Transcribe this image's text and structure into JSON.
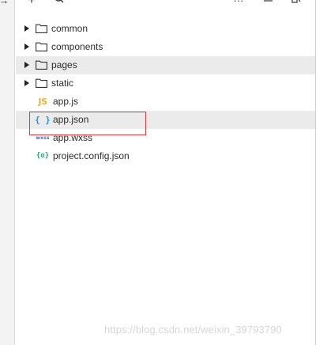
{
  "toolbar": {
    "icons": [
      "arrow-right-icon",
      "plus-icon",
      "search-icon",
      "more-icon",
      "collapse-icon",
      "layout-icon"
    ]
  },
  "tree": {
    "items": [
      {
        "label": "common",
        "type": "folder",
        "highlighted": false
      },
      {
        "label": "components",
        "type": "folder",
        "highlighted": false
      },
      {
        "label": "pages",
        "type": "folder",
        "highlighted": true
      },
      {
        "label": "static",
        "type": "folder",
        "highlighted": false
      },
      {
        "label": "app.js",
        "type": "file",
        "icon": "JS",
        "highlighted": false
      },
      {
        "label": "app.json",
        "type": "file",
        "icon": "{ }",
        "highlighted": true
      },
      {
        "label": "app.wxss",
        "type": "file",
        "icon": "wxss",
        "highlighted": false
      },
      {
        "label": "project.config.json",
        "type": "file",
        "icon": "{o}",
        "highlighted": false
      }
    ]
  },
  "watermark": "https://blog.csdn.net/weixin_39793790",
  "colors": {
    "accent_red": "#e0393e",
    "js": "#e9b22f",
    "json": "#2f8fd8",
    "config": "#1aa876",
    "highlight_row": "#ebebeb"
  }
}
